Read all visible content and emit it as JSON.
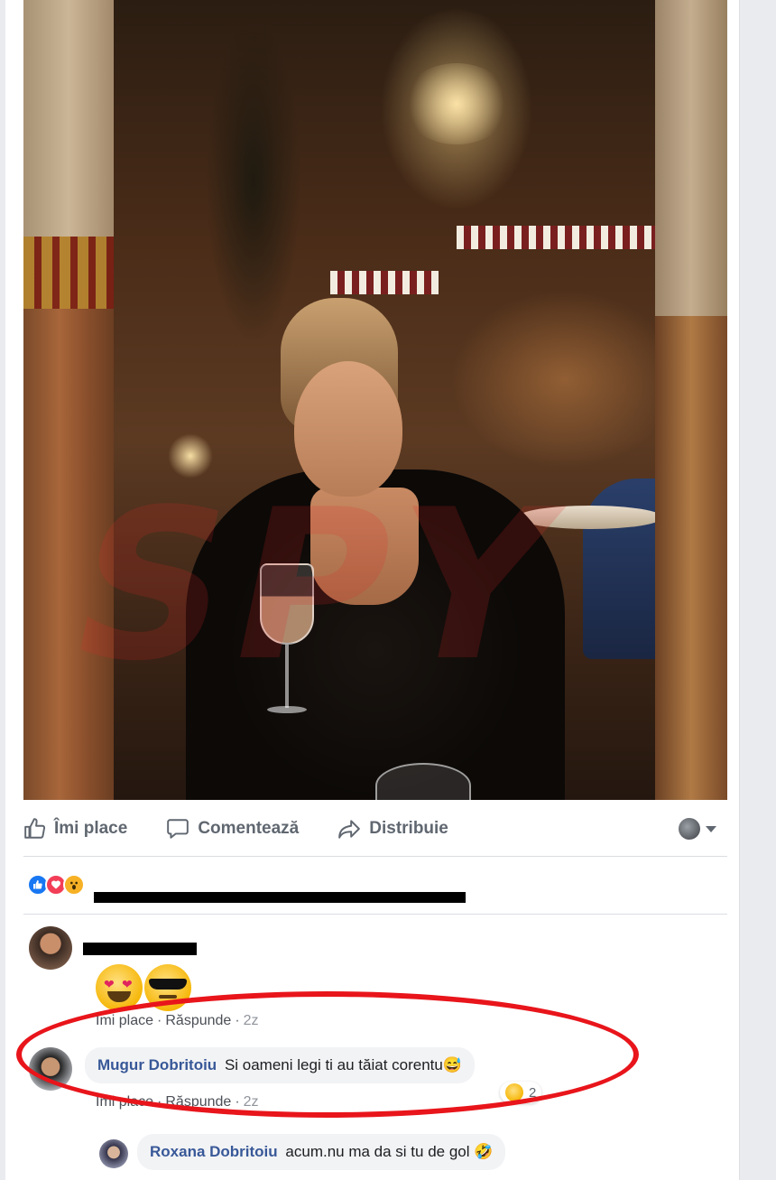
{
  "actions": {
    "like_label": "Îmi place",
    "comment_label": "Comentează",
    "share_label": "Distribuie"
  },
  "watermark": "SPY",
  "comments": [
    {
      "emojis": [
        "heart-eyes-emoji",
        "sunglasses-emoji"
      ],
      "like_label": "Îmi place",
      "reply_label": "Răspunde",
      "time": "2z"
    },
    {
      "author": "Mugur Dobritoiu",
      "text": "Si oameni legi ti au tăiat corentu😅",
      "reaction_count": "2",
      "like_label": "Îmi place",
      "reply_label": "Răspunde",
      "time": "2z"
    },
    {
      "author": "Roxana Dobritoiu",
      "text": "acum.nu ma da si tu de gol 🤣"
    }
  ],
  "colors": {
    "link": "#385898",
    "annotation": "#e8151b",
    "like_blue": "#1877f2",
    "love_red": "#f33e58"
  }
}
